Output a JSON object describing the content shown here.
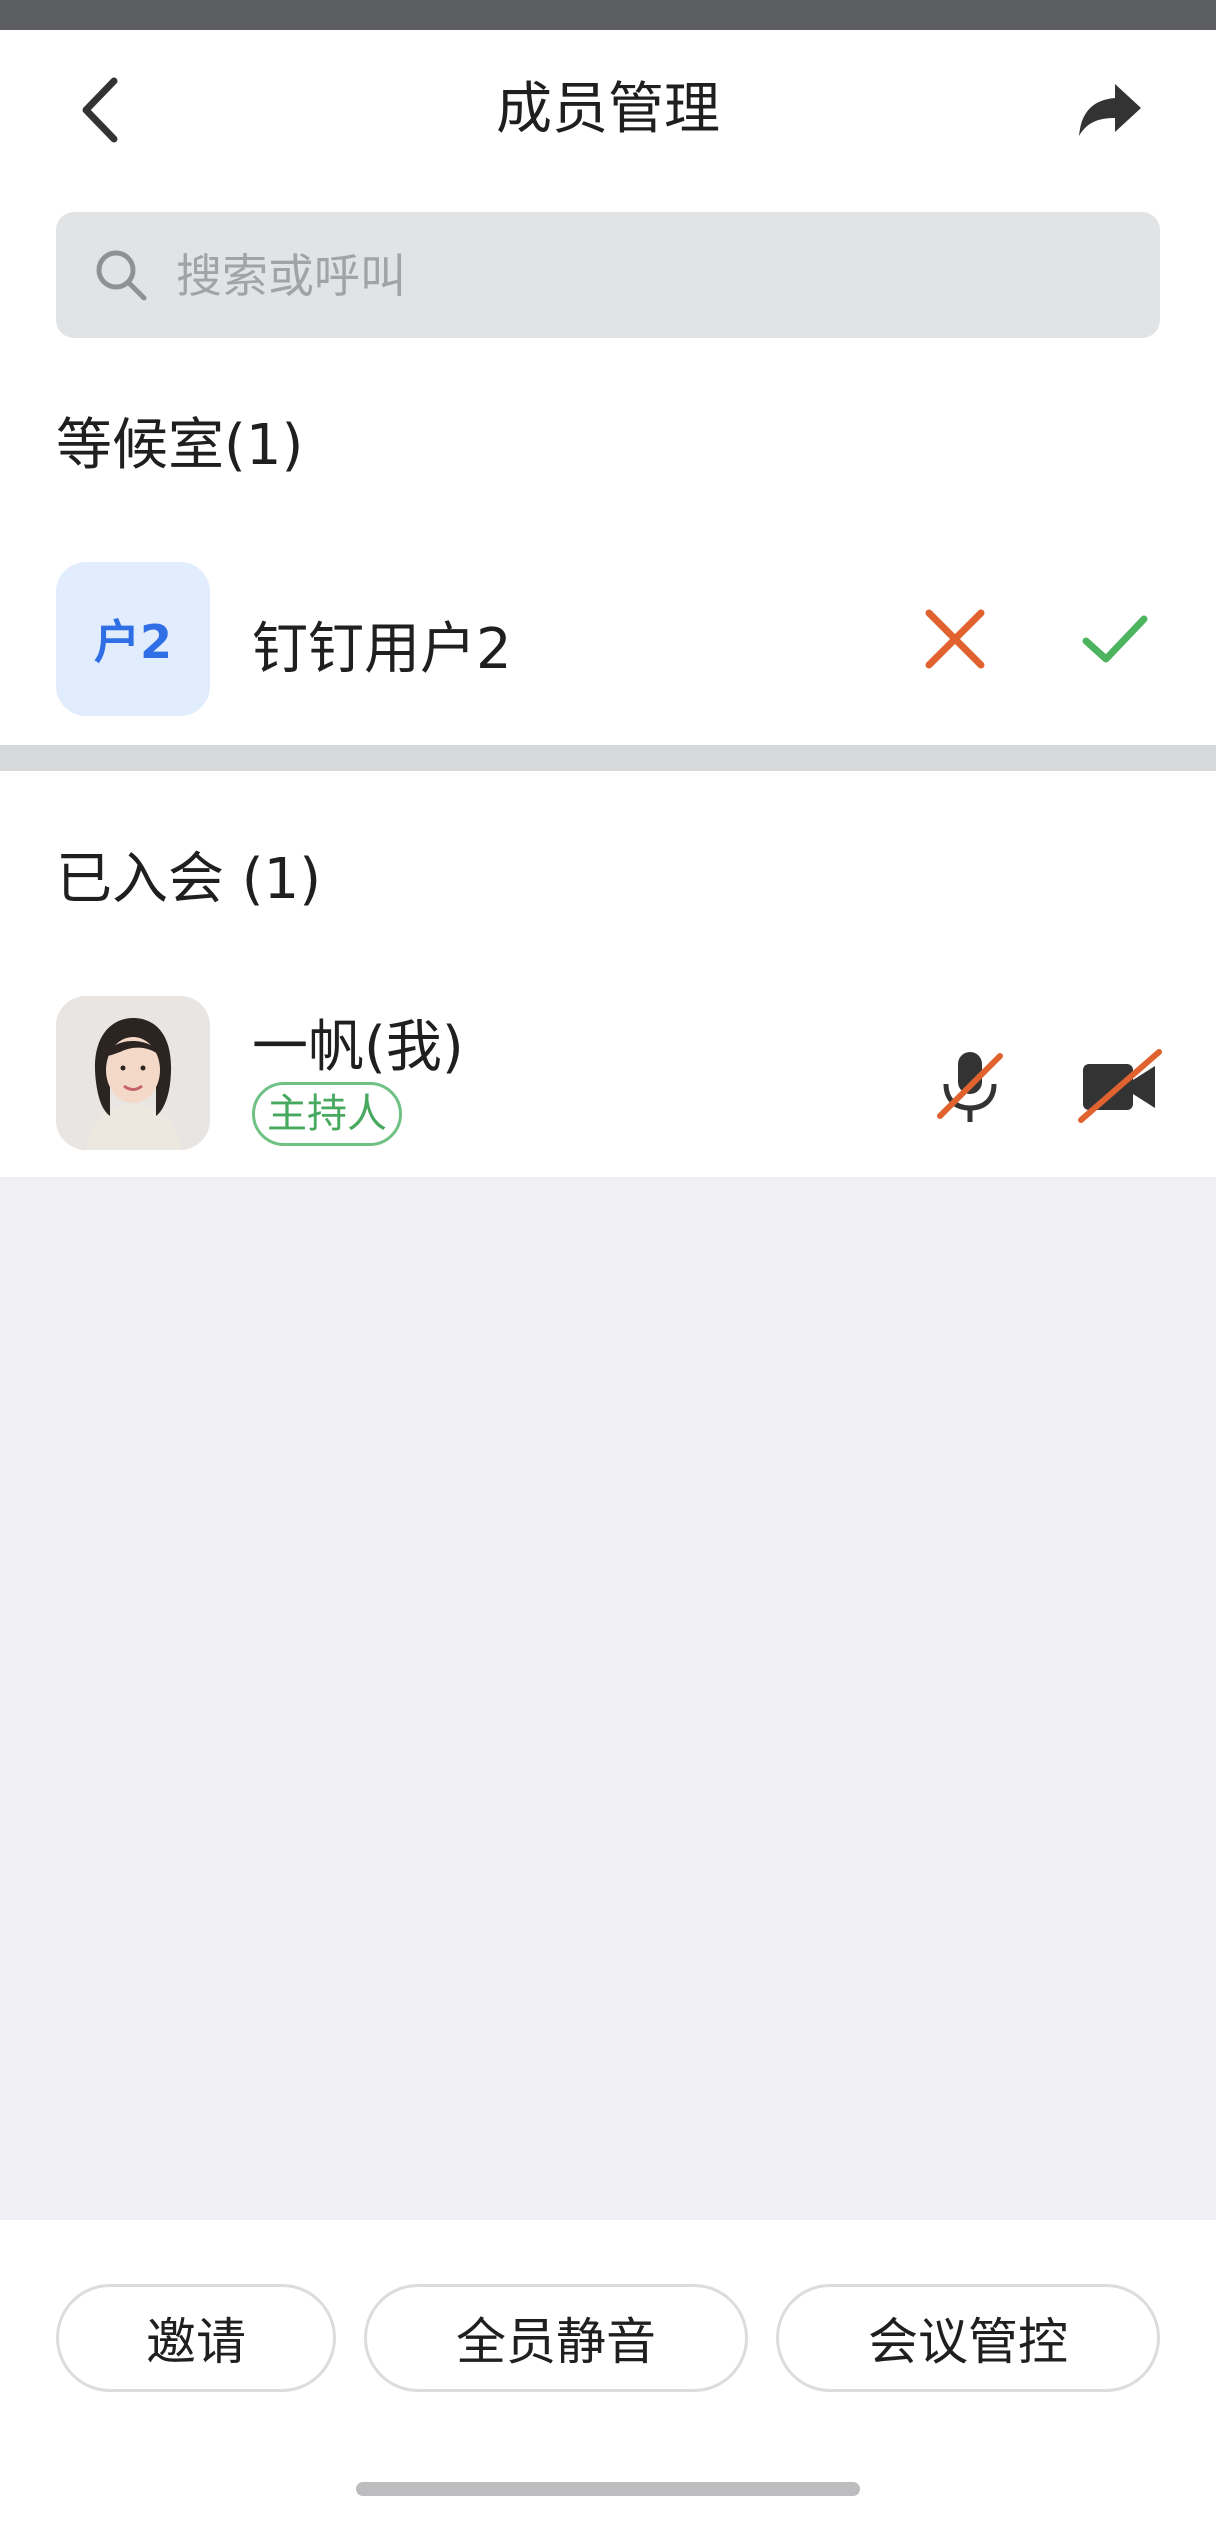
{
  "header": {
    "title": "成员管理"
  },
  "search": {
    "placeholder": "搜索或呼叫"
  },
  "waiting_room": {
    "title": "等候室(1)",
    "members": [
      {
        "avatar_text": "户2",
        "name": "钉钉用户2"
      }
    ]
  },
  "joined": {
    "title": "已入会 (1)",
    "members": [
      {
        "name": "一帆(我)",
        "role_badge": "主持人",
        "mic": "muted",
        "camera": "off"
      }
    ]
  },
  "actions": {
    "invite": "邀请",
    "mute_all": "全员静音",
    "meeting_control": "会议管控"
  },
  "colors": {
    "accent_blue": "#2f6ee5",
    "reject_orange": "#e0632f",
    "accept_green": "#4cb35f",
    "muted_slash": "#e0632f",
    "badge_green": "#46a95f"
  },
  "icons": [
    "back-arrow-icon",
    "share-icon",
    "search-icon",
    "close-icon",
    "check-icon",
    "microphone-muted-icon",
    "camera-off-icon"
  ]
}
